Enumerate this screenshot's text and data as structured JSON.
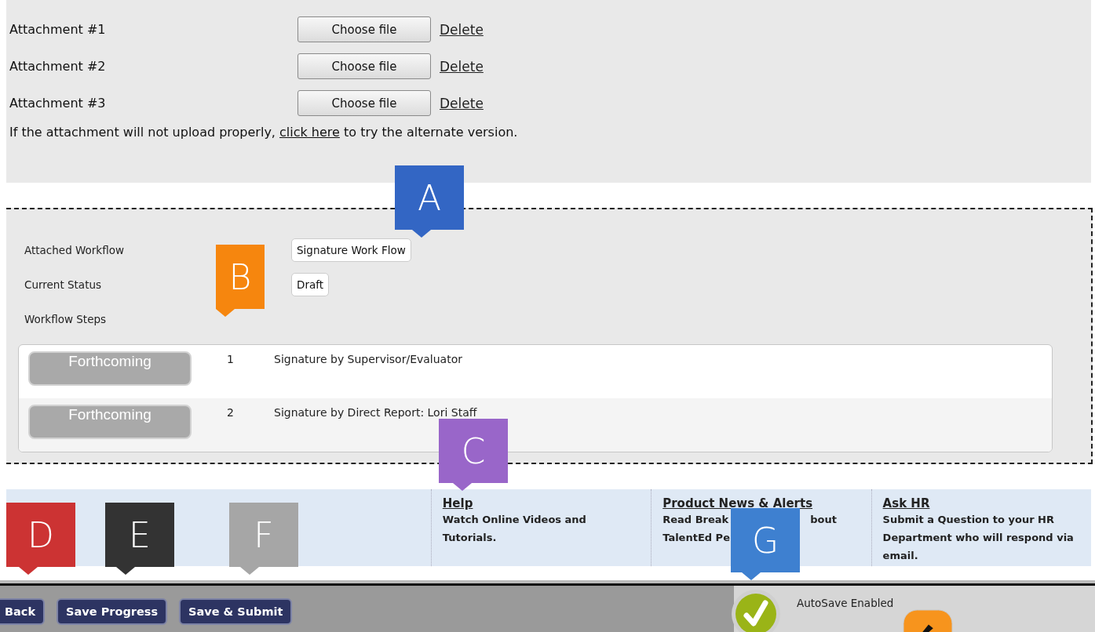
{
  "attachments": {
    "rows": [
      {
        "label": "Attachment #1",
        "button": "Choose file",
        "link": "Delete"
      },
      {
        "label": "Attachment #2",
        "button": "Choose file",
        "link": "Delete"
      },
      {
        "label": "Attachment #3",
        "button": "Choose file",
        "link": "Delete"
      }
    ],
    "note": {
      "before": "If the attachment will not upload properly, ",
      "link": "click here",
      "after": " to try the alternate version."
    }
  },
  "workflow": {
    "fields": [
      {
        "label": "Attached Workflow",
        "value": "Signature Work Flow"
      },
      {
        "label": "Current Status",
        "value": "Draft"
      },
      {
        "label": "Workflow Steps"
      }
    ],
    "steps": [
      {
        "status": "Forthcoming",
        "number": "1",
        "name": "Signature by Supervisor/Evaluator"
      },
      {
        "status": "Forthcoming",
        "number": "2",
        "name": "Signature by Direct Report: Lori Staff"
      }
    ]
  },
  "footer_links": [
    {
      "title": "Help",
      "lines": [
        [
          "Watch Online Videos and"
        ],
        [
          "Tutorials."
        ]
      ]
    },
    {
      "title": "Product News & Alerts",
      "lines": [
        [
          "Read Break",
          "bout"
        ],
        [
          "TalentEd Pe"
        ]
      ]
    },
    {
      "title": "Ask HR",
      "lines": [
        [
          "Submit a Question to your HR"
        ],
        [
          "Department who will respond via"
        ],
        [
          "email."
        ]
      ]
    }
  ],
  "action_bar": {
    "buttons": [
      "Back",
      "Save Progress",
      "Save & Submit"
    ],
    "autosave": "AutoSave Enabled"
  },
  "callouts": [
    {
      "letter": "A",
      "color": "#3366c4"
    },
    {
      "letter": "B",
      "color": "#f6860e"
    },
    {
      "letter": "C",
      "color": "#9966c9"
    },
    {
      "letter": "D",
      "color": "#cc3333"
    },
    {
      "letter": "E",
      "color": "#333333"
    },
    {
      "letter": "F",
      "color": "#a6a6a6"
    },
    {
      "letter": "G",
      "color": "#3e80d0"
    }
  ]
}
